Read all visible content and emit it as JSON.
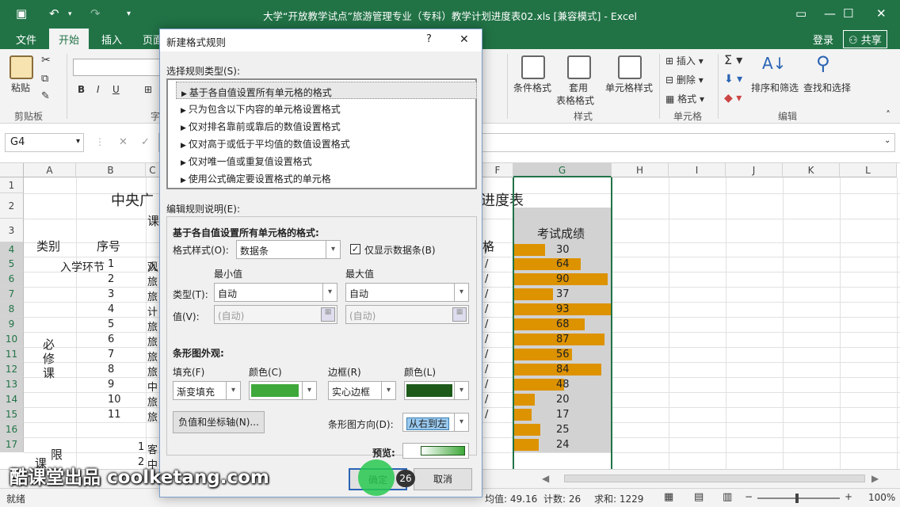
{
  "titlebar": {
    "title": "大学“开放教学试点”旅游管理专业（专科）教学计划进度表02.xls  [兼容模式] - Excel"
  },
  "tabs": {
    "file": "文件",
    "home": "开始",
    "insert": "插入",
    "page": "页面",
    "login": "登录",
    "share": "共享"
  },
  "ribbon": {
    "paste": "粘贴",
    "clipboard": "剪贴板",
    "conditional_format": "条件格式",
    "table_format_1": "套用",
    "table_format_2": "表格格式",
    "cell_style": "单元格样式",
    "style_group": "样式",
    "insert": "插入",
    "delete": "删除",
    "format": "格式",
    "cells_group": "单元格",
    "sort_filter": "排序和筛选",
    "find_select": "查找和选择",
    "edit_group": "编辑",
    "font_partial": "字"
  },
  "formula": {
    "namebox": "G4"
  },
  "grid": {
    "columns": [
      "A",
      "B",
      "C",
      "F",
      "G",
      "H",
      "I",
      "J",
      "K",
      "L"
    ],
    "rows": [
      "1",
      "2",
      "3",
      "4",
      "5",
      "6",
      "7",
      "8",
      "9",
      "10",
      "11",
      "12",
      "13",
      "14",
      "15",
      "16",
      "17"
    ],
    "title_left": "中央广",
    "title_right": "进度表",
    "row2_left": "课",
    "hdr_type": "类别",
    "hdr_no": "序号",
    "hdr_f": "格",
    "hdr_exam": "考试成绩",
    "enroll": "入学环节",
    "enroll_c": "入",
    "required_1": "必",
    "required_2": "修",
    "required_3": "课",
    "limit_1": "限",
    "limit_2": "课",
    "numbers": [
      "1",
      "2",
      "3",
      "4",
      "5",
      "6",
      "7",
      "8",
      "9",
      "10",
      "11"
    ],
    "c_chars": [
      "观",
      "旅",
      "旅",
      "计",
      "旅",
      "旅",
      "旅",
      "旅",
      "中",
      "旅",
      "旅"
    ],
    "r16_no": "1",
    "r16_c": "客",
    "r17_no": "2",
    "r17_c": "中",
    "f_marks": "/",
    "scores": [
      30,
      64,
      90,
      37,
      93,
      68,
      87,
      56,
      84,
      48,
      20,
      17,
      25,
      24
    ],
    "score_max": 93
  },
  "status": {
    "ready": "就绪",
    "average": "均值: 49.16",
    "count": "计数: 26",
    "sum": "求和: 1229",
    "zoom": "100%"
  },
  "dialog": {
    "title": "新建格式规则",
    "help": "?",
    "close": "✕",
    "select_rule_type": "选择规则类型(S):",
    "rule_types": [
      "基于各自值设置所有单元格的格式",
      "只为包含以下内容的单元格设置格式",
      "仅对排名靠前或靠后的数值设置格式",
      "仅对高于或低于平均值的数值设置格式",
      "仅对唯一值或重复值设置格式",
      "使用公式确定要设置格式的单元格"
    ],
    "selected_rule_index": 0,
    "edit_rule_desc": "编辑规则说明(E):",
    "desc_heading": "基于各自值设置所有单元格的格式:",
    "format_style_label": "格式样式(O):",
    "format_style_value": "数据条",
    "show_bar_only": "仅显示数据条(B)",
    "show_bar_only_checked": true,
    "min_label": "最小值",
    "max_label": "最大值",
    "type_label": "类型(T):",
    "value_label": "值(V):",
    "min_type": "自动",
    "max_type": "自动",
    "min_value": "(自动)",
    "max_value": "(自动)",
    "bar_appearance": "条形图外观:",
    "fill_label": "填充(F)",
    "fill_value": "渐变填充",
    "color_label": "颜色(C)",
    "fill_color": "#3ea83a",
    "border_label": "边框(R)",
    "border_value": "实心边框",
    "border_color_label": "颜色(L)",
    "border_color": "#1d5a1a",
    "neg_axis_button": "负值和坐标轴(N)...",
    "direction_label": "条形图方向(D):",
    "direction_value": "从右到左",
    "preview_label": "预览:",
    "ok": "确定",
    "cancel": "取消"
  },
  "overlay": {
    "badge_number": "26",
    "watermark": "酷课堂出品 coolketang.com"
  }
}
